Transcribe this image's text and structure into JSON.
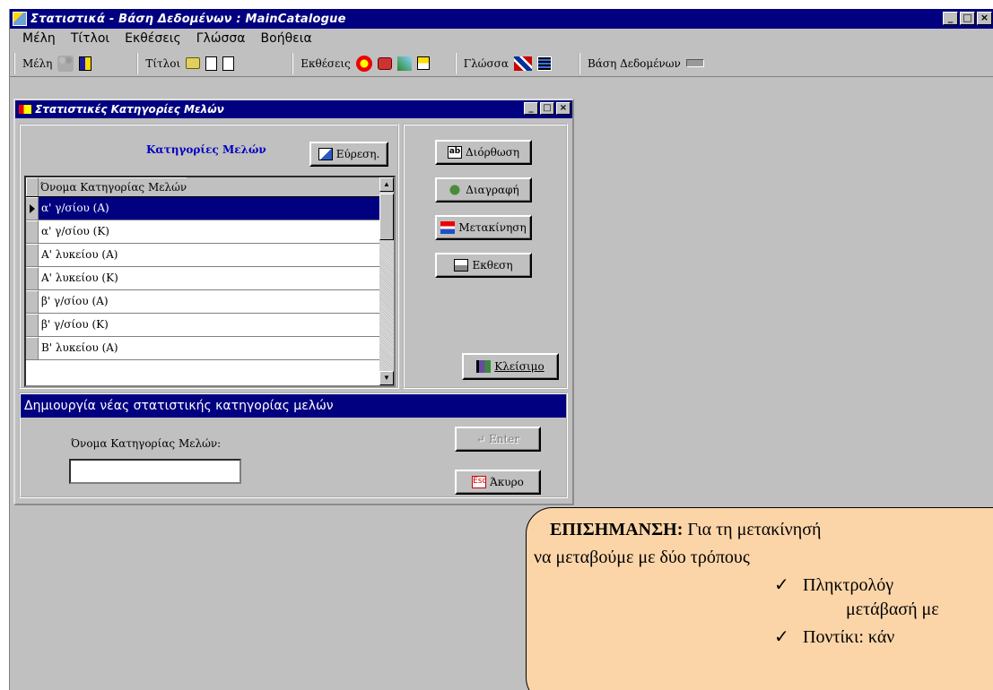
{
  "window": {
    "title": "Στατιστικά - Βάση Δεδομένων : MainCatalogue",
    "controls": [
      "_",
      "□",
      "×"
    ]
  },
  "menu": [
    {
      "label": "Μέλη",
      "id": "members"
    },
    {
      "label": "Τίτλοι",
      "id": "titles"
    },
    {
      "label": "Εκθέσεις",
      "id": "reports"
    },
    {
      "label": "Γλώσσα",
      "id": "language"
    },
    {
      "label": "Βοήθεια",
      "id": "help"
    }
  ],
  "toolbar": {
    "members_label": "Μέλη",
    "titles_label": "Τίτλοι",
    "reports_label": "Εκθέσεις",
    "language_label": "Γλώσσα",
    "database_label": "Βάση Δεδομένων"
  },
  "child": {
    "title": "Στατιστικές Κατηγορίες Μελών",
    "heading": "Κατηγορίες Μελών",
    "find_button": "Εύρεση.",
    "column_header": "Όνομα Κατηγορίας Μελών",
    "rows": [
      "α' γ/σίου (Α)",
      "α' γ/σίου (Κ)",
      "Α' λυκείου (Α)",
      "Α' λυκείου (Κ)",
      "β' γ/σίου (Α)",
      "β' γ/σίου (Κ)",
      "Β' λυκείου (Α)"
    ],
    "selected_row": 0,
    "buttons": {
      "edit": "Διόρθωση",
      "edit_icon": "ab",
      "delete": "Διαγραφή",
      "move": "Μετακίνηση",
      "report": "Εκθεση",
      "close": "Κλείσιμο"
    }
  },
  "new_category": {
    "title": "Δημιουργία νέας στατιστικής κατηγορίας μελών",
    "field_label": "Όνομα Κατηγορίας Μελών:",
    "field_value": "",
    "enter_button": "Enter",
    "cancel_button": "Άκυρο",
    "esc_icon": "Esc"
  },
  "callout": {
    "heading": "ΕΠΙΣΗΜΑΝΣΗ:",
    "line1": " Για τη μετακίνησή",
    "line2": "να μεταβούμε με δύο τρόπους",
    "bullet1": "Πληκτρολόγ",
    "bullet1_cont": "μετάβασή με",
    "bullet2": "Ποντίκι: κάν",
    "check_glyph": "✓"
  }
}
